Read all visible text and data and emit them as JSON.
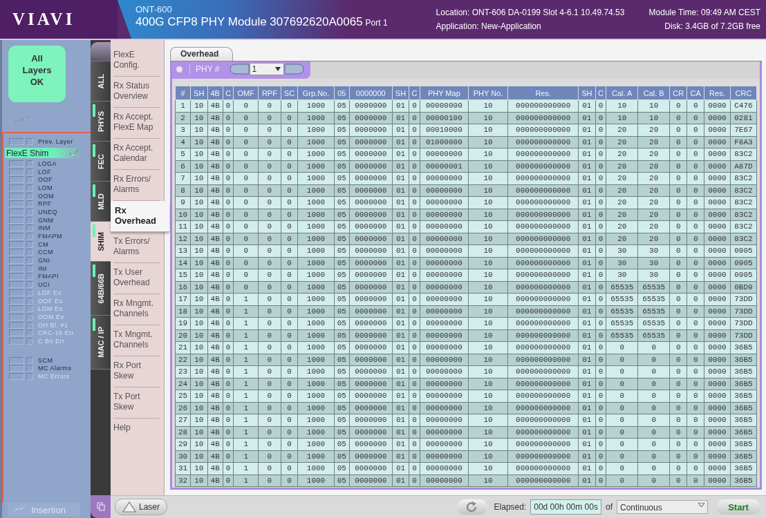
{
  "header": {
    "logo": "VIAVI",
    "model": "ONT-600",
    "module": "400G CFP8 PHY Module 307692620A0065",
    "port": "Port 1",
    "location": "Location: ONT-606 DA-0199 Slot 4-6.1  10.49.74.53",
    "module_time": "Module Time: 09:49 AM CEST",
    "application": "Application: New-Application",
    "disk": "Disk: 3.4GB of 7.2GB free"
  },
  "summary": {
    "label": "All\nLayers\nOK"
  },
  "prev_layer": {
    "label": "Prev. Layer"
  },
  "current_layer": {
    "label": "FlexE Shim",
    "checked": true
  },
  "alarm_groups": [
    [
      {
        "label": "LOGA",
        "disabled": false
      },
      {
        "label": "LOF",
        "disabled": false
      },
      {
        "label": "OOF",
        "disabled": false
      },
      {
        "label": "LOM",
        "disabled": false
      },
      {
        "label": "OOM",
        "disabled": false
      },
      {
        "label": "RPF",
        "disabled": false
      },
      {
        "label": "UNEQ",
        "disabled": false
      },
      {
        "label": "GNM",
        "disabled": false
      },
      {
        "label": "INM",
        "disabled": false
      },
      {
        "label": "FMAPM",
        "disabled": false
      },
      {
        "label": "CM",
        "disabled": false
      },
      {
        "label": "CCM",
        "disabled": false
      },
      {
        "label": "GNI",
        "disabled": false
      },
      {
        "label": "INI",
        "disabled": false
      },
      {
        "label": "FMAPI",
        "disabled": false
      },
      {
        "label": "UCI",
        "disabled": false
      },
      {
        "label": "LOF Ev.",
        "disabled": true
      },
      {
        "label": "OOF Ev.",
        "disabled": true
      },
      {
        "label": "LOM Ev.",
        "disabled": true
      },
      {
        "label": "OOM Ev.",
        "disabled": true
      },
      {
        "label": "OH Bl. #1",
        "disabled": true
      },
      {
        "label": "CRC-16 Err.",
        "disabled": true
      },
      {
        "label": "C Bit Err.",
        "disabled": true
      }
    ],
    [
      {
        "label": "SCM",
        "disabled": false
      },
      {
        "label": "MC Alarms",
        "disabled": false
      },
      {
        "label": "MC Errors",
        "disabled": true
      }
    ]
  ],
  "insertion": "Insertion",
  "layer_tabs": [
    {
      "label": "ALL",
      "selected": false,
      "indicator": false
    },
    {
      "label": "PHYS",
      "selected": false,
      "indicator": true
    },
    {
      "label": "FEC",
      "selected": false,
      "indicator": true
    },
    {
      "label": "MLD",
      "selected": false,
      "indicator": true
    },
    {
      "label": "SHIM",
      "selected": true,
      "indicator": true
    },
    {
      "label": "64B/66B",
      "selected": false,
      "indicator": true
    },
    {
      "label": "MAC / IP",
      "selected": false,
      "indicator": true
    }
  ],
  "menu": [
    {
      "label": "FlexE\nConfig.",
      "selected": false
    },
    {
      "label": "Rx Status\nOverview",
      "selected": false
    },
    {
      "label": "Rx Accept.\nFlexE Map",
      "selected": false
    },
    {
      "label": "Rx Accept.\nCalendar",
      "selected": false
    },
    {
      "label": "Rx Errors/\nAlarms",
      "selected": false
    },
    {
      "label": "Rx\nOverhead",
      "selected": true
    },
    {
      "label": "Tx Errors/\nAlarms",
      "selected": false
    },
    {
      "label": "Tx User\nOverhead",
      "selected": false
    },
    {
      "label": "Rx Mngmt.\nChannels",
      "selected": false
    },
    {
      "label": "Tx Mngmt.\nChannels",
      "selected": false
    },
    {
      "label": "Rx Port\nSkew",
      "selected": false
    },
    {
      "label": "Tx Port\nSkew",
      "selected": false
    },
    {
      "label": "Help",
      "selected": false
    }
  ],
  "panel": {
    "tab": "Overhead",
    "phy_label": "PHY #",
    "phy_value": "1"
  },
  "table": {
    "columns": [
      "#",
      "SH",
      "4B",
      "C",
      "OMF",
      "RPF",
      "SC",
      "Grp.No.",
      "05",
      "0000000",
      "SH",
      "C",
      "PHY Map",
      "PHY No.",
      "Res.",
      "SH",
      "C",
      "Cal. A",
      "Cal. B",
      "CR",
      "CA",
      "Res.",
      "CRC"
    ],
    "rows": [
      [
        "1",
        "10",
        "4B",
        "0",
        "0",
        "0",
        "0",
        "1000",
        "05",
        "0000000",
        "01",
        "0",
        "00000000",
        "10",
        "000000000000",
        "01",
        "0",
        "10",
        "10",
        "0",
        "0",
        "0000",
        "C476"
      ],
      [
        "2",
        "10",
        "4B",
        "0",
        "0",
        "0",
        "0",
        "1000",
        "05",
        "0000000",
        "01",
        "0",
        "00000100",
        "10",
        "000000000000",
        "01",
        "0",
        "10",
        "10",
        "0",
        "0",
        "0000",
        "0281"
      ],
      [
        "3",
        "10",
        "4B",
        "0",
        "0",
        "0",
        "0",
        "1000",
        "05",
        "0000000",
        "01",
        "0",
        "00010000",
        "10",
        "000000000000",
        "01",
        "0",
        "20",
        "20",
        "0",
        "0",
        "0000",
        "7E67"
      ],
      [
        "4",
        "10",
        "4B",
        "0",
        "0",
        "0",
        "0",
        "1000",
        "05",
        "0000000",
        "01",
        "0",
        "01000000",
        "10",
        "000000000000",
        "01",
        "0",
        "20",
        "20",
        "0",
        "0",
        "0000",
        "F8A3"
      ],
      [
        "5",
        "10",
        "4B",
        "0",
        "0",
        "0",
        "0",
        "1000",
        "05",
        "0000000",
        "01",
        "0",
        "00000000",
        "10",
        "000000000000",
        "01",
        "0",
        "20",
        "20",
        "0",
        "0",
        "0000",
        "83C2"
      ],
      [
        "6",
        "10",
        "4B",
        "0",
        "0",
        "0",
        "0",
        "1000",
        "05",
        "0000000",
        "01",
        "0",
        "00000001",
        "10",
        "000000000000",
        "01",
        "0",
        "20",
        "20",
        "0",
        "0",
        "0000",
        "A87D"
      ],
      [
        "7",
        "10",
        "4B",
        "0",
        "0",
        "0",
        "0",
        "1000",
        "05",
        "0000000",
        "01",
        "0",
        "00000000",
        "10",
        "000000000000",
        "01",
        "0",
        "20",
        "20",
        "0",
        "0",
        "0000",
        "83C2"
      ],
      [
        "8",
        "10",
        "4B",
        "0",
        "0",
        "0",
        "0",
        "1000",
        "05",
        "0000000",
        "01",
        "0",
        "00000000",
        "10",
        "000000000000",
        "01",
        "0",
        "20",
        "20",
        "0",
        "0",
        "0000",
        "83C2"
      ],
      [
        "9",
        "10",
        "4B",
        "0",
        "0",
        "0",
        "0",
        "1000",
        "05",
        "0000000",
        "01",
        "0",
        "00000000",
        "10",
        "000000000000",
        "01",
        "0",
        "20",
        "20",
        "0",
        "0",
        "0000",
        "83C2"
      ],
      [
        "10",
        "10",
        "4B",
        "0",
        "0",
        "0",
        "0",
        "1000",
        "05",
        "0000000",
        "01",
        "0",
        "00000000",
        "10",
        "000000000000",
        "01",
        "0",
        "20",
        "20",
        "0",
        "0",
        "0000",
        "83C2"
      ],
      [
        "11",
        "10",
        "4B",
        "0",
        "0",
        "0",
        "0",
        "1000",
        "05",
        "0000000",
        "01",
        "0",
        "00000000",
        "10",
        "000000000000",
        "01",
        "0",
        "20",
        "20",
        "0",
        "0",
        "0000",
        "83C2"
      ],
      [
        "12",
        "10",
        "4B",
        "0",
        "0",
        "0",
        "0",
        "1000",
        "05",
        "0000000",
        "01",
        "0",
        "00000000",
        "10",
        "000000000000",
        "01",
        "0",
        "20",
        "20",
        "0",
        "0",
        "0000",
        "83C2"
      ],
      [
        "13",
        "10",
        "4B",
        "0",
        "0",
        "0",
        "0",
        "1000",
        "05",
        "0000000",
        "01",
        "0",
        "00000000",
        "10",
        "000000000000",
        "01",
        "0",
        "30",
        "30",
        "0",
        "0",
        "0000",
        "0905"
      ],
      [
        "14",
        "10",
        "4B",
        "0",
        "0",
        "0",
        "0",
        "1000",
        "05",
        "0000000",
        "01",
        "0",
        "00000000",
        "10",
        "000000000000",
        "01",
        "0",
        "30",
        "30",
        "0",
        "0",
        "0000",
        "0905"
      ],
      [
        "15",
        "10",
        "4B",
        "0",
        "0",
        "0",
        "0",
        "1000",
        "05",
        "0000000",
        "01",
        "0",
        "00000000",
        "10",
        "000000000000",
        "01",
        "0",
        "30",
        "30",
        "0",
        "0",
        "0000",
        "0905"
      ],
      [
        "16",
        "10",
        "4B",
        "0",
        "0",
        "0",
        "0",
        "1000",
        "05",
        "0000000",
        "01",
        "0",
        "00000000",
        "10",
        "000000000000",
        "01",
        "0",
        "65535",
        "65535",
        "0",
        "0",
        "0000",
        "0BD9"
      ],
      [
        "17",
        "10",
        "4B",
        "0",
        "1",
        "0",
        "0",
        "1000",
        "05",
        "0000000",
        "01",
        "0",
        "00000000",
        "10",
        "000000000000",
        "01",
        "0",
        "65535",
        "65535",
        "0",
        "0",
        "0000",
        "73DD"
      ],
      [
        "18",
        "10",
        "4B",
        "0",
        "1",
        "0",
        "0",
        "1000",
        "05",
        "0000000",
        "01",
        "0",
        "00000000",
        "10",
        "000000000000",
        "01",
        "0",
        "65535",
        "65535",
        "0",
        "0",
        "0000",
        "73DD"
      ],
      [
        "19",
        "10",
        "4B",
        "0",
        "1",
        "0",
        "0",
        "1000",
        "05",
        "0000000",
        "01",
        "0",
        "00000000",
        "10",
        "000000000000",
        "01",
        "0",
        "65535",
        "65535",
        "0",
        "0",
        "0000",
        "73DD"
      ],
      [
        "20",
        "10",
        "4B",
        "0",
        "1",
        "0",
        "0",
        "1000",
        "05",
        "0000000",
        "01",
        "0",
        "00000000",
        "10",
        "000000000000",
        "01",
        "0",
        "65535",
        "65535",
        "0",
        "0",
        "0000",
        "73DD"
      ],
      [
        "21",
        "10",
        "4B",
        "0",
        "1",
        "0",
        "0",
        "1000",
        "05",
        "0000000",
        "01",
        "0",
        "00000000",
        "10",
        "000000000000",
        "01",
        "0",
        "0",
        "0",
        "0",
        "0",
        "0000",
        "36B5"
      ],
      [
        "22",
        "10",
        "4B",
        "0",
        "1",
        "0",
        "0",
        "1000",
        "05",
        "0000000",
        "01",
        "0",
        "00000000",
        "10",
        "000000000000",
        "01",
        "0",
        "0",
        "0",
        "0",
        "0",
        "0000",
        "36B5"
      ],
      [
        "23",
        "10",
        "4B",
        "0",
        "1",
        "0",
        "0",
        "1000",
        "05",
        "0000000",
        "01",
        "0",
        "00000000",
        "10",
        "000000000000",
        "01",
        "0",
        "0",
        "0",
        "0",
        "0",
        "0000",
        "36B5"
      ],
      [
        "24",
        "10",
        "4B",
        "0",
        "1",
        "0",
        "0",
        "1000",
        "05",
        "0000000",
        "01",
        "0",
        "00000000",
        "10",
        "000000000000",
        "01",
        "0",
        "0",
        "0",
        "0",
        "0",
        "0000",
        "36B5"
      ],
      [
        "25",
        "10",
        "4B",
        "0",
        "1",
        "0",
        "0",
        "1000",
        "05",
        "0000000",
        "01",
        "0",
        "00000000",
        "10",
        "000000000000",
        "01",
        "0",
        "0",
        "0",
        "0",
        "0",
        "0000",
        "36B5"
      ],
      [
        "26",
        "10",
        "4B",
        "0",
        "1",
        "0",
        "0",
        "1000",
        "05",
        "0000000",
        "01",
        "0",
        "00000000",
        "10",
        "000000000000",
        "01",
        "0",
        "0",
        "0",
        "0",
        "0",
        "0000",
        "36B5"
      ],
      [
        "27",
        "10",
        "4B",
        "0",
        "1",
        "0",
        "0",
        "1000",
        "05",
        "0000000",
        "01",
        "0",
        "00000000",
        "10",
        "000000000000",
        "01",
        "0",
        "0",
        "0",
        "0",
        "0",
        "0000",
        "36B5"
      ],
      [
        "28",
        "10",
        "4B",
        "0",
        "1",
        "0",
        "0",
        "1000",
        "05",
        "0000000",
        "01",
        "0",
        "00000000",
        "10",
        "000000000000",
        "01",
        "0",
        "0",
        "0",
        "0",
        "0",
        "0000",
        "36B5"
      ],
      [
        "29",
        "10",
        "4B",
        "0",
        "1",
        "0",
        "0",
        "1000",
        "05",
        "0000000",
        "01",
        "0",
        "00000000",
        "10",
        "000000000000",
        "01",
        "0",
        "0",
        "0",
        "0",
        "0",
        "0000",
        "36B5"
      ],
      [
        "30",
        "10",
        "4B",
        "0",
        "1",
        "0",
        "0",
        "1000",
        "05",
        "0000000",
        "01",
        "0",
        "00000000",
        "10",
        "000000000000",
        "01",
        "0",
        "0",
        "0",
        "0",
        "0",
        "0000",
        "36B5"
      ],
      [
        "31",
        "10",
        "4B",
        "0",
        "1",
        "0",
        "0",
        "1000",
        "05",
        "0000000",
        "01",
        "0",
        "00000000",
        "10",
        "000000000000",
        "01",
        "0",
        "0",
        "0",
        "0",
        "0",
        "0000",
        "36B5"
      ],
      [
        "32",
        "10",
        "4B",
        "0",
        "1",
        "0",
        "0",
        "1000",
        "05",
        "0000000",
        "01",
        "0",
        "00000000",
        "10",
        "000000000000",
        "01",
        "0",
        "0",
        "0",
        "0",
        "0",
        "0000",
        "36B5"
      ]
    ]
  },
  "footer": {
    "laser": "Laser",
    "elapsed_label": "Elapsed:",
    "elapsed": "00d 00h 00m 00s",
    "of": "of",
    "duration": "Continuous",
    "start": "Start"
  }
}
